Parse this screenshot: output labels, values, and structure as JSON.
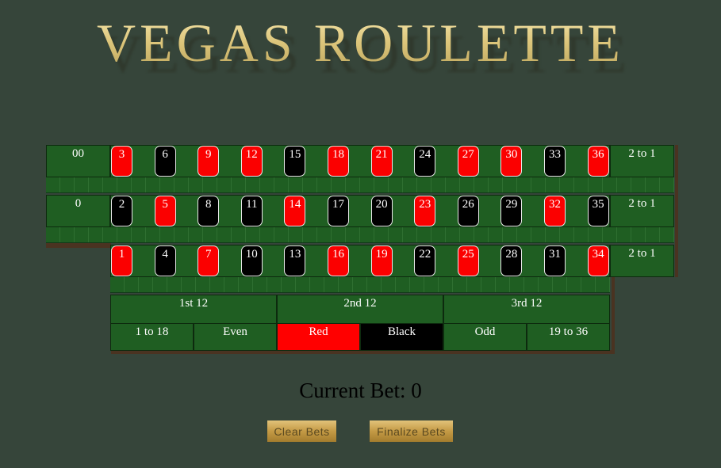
{
  "title": "VEGAS ROULETTE",
  "board": {
    "zeros": [
      "00",
      "0"
    ],
    "rows": [
      [
        {
          "n": "3",
          "c": "red"
        },
        {
          "n": "6",
          "c": "black"
        },
        {
          "n": "9",
          "c": "red"
        },
        {
          "n": "12",
          "c": "red"
        },
        {
          "n": "15",
          "c": "black"
        },
        {
          "n": "18",
          "c": "red"
        },
        {
          "n": "21",
          "c": "red"
        },
        {
          "n": "24",
          "c": "black"
        },
        {
          "n": "27",
          "c": "red"
        },
        {
          "n": "30",
          "c": "red"
        },
        {
          "n": "33",
          "c": "black"
        },
        {
          "n": "36",
          "c": "red"
        }
      ],
      [
        {
          "n": "2",
          "c": "black"
        },
        {
          "n": "5",
          "c": "red"
        },
        {
          "n": "8",
          "c": "black"
        },
        {
          "n": "11",
          "c": "black"
        },
        {
          "n": "14",
          "c": "red"
        },
        {
          "n": "17",
          "c": "black"
        },
        {
          "n": "20",
          "c": "black"
        },
        {
          "n": "23",
          "c": "red"
        },
        {
          "n": "26",
          "c": "black"
        },
        {
          "n": "29",
          "c": "black"
        },
        {
          "n": "32",
          "c": "red"
        },
        {
          "n": "35",
          "c": "black"
        }
      ],
      [
        {
          "n": "1",
          "c": "red"
        },
        {
          "n": "4",
          "c": "black"
        },
        {
          "n": "7",
          "c": "red"
        },
        {
          "n": "10",
          "c": "black"
        },
        {
          "n": "13",
          "c": "black"
        },
        {
          "n": "16",
          "c": "red"
        },
        {
          "n": "19",
          "c": "red"
        },
        {
          "n": "22",
          "c": "black"
        },
        {
          "n": "25",
          "c": "red"
        },
        {
          "n": "28",
          "c": "black"
        },
        {
          "n": "31",
          "c": "black"
        },
        {
          "n": "34",
          "c": "red"
        }
      ]
    ],
    "column_bets": [
      "2 to 1",
      "2 to 1",
      "2 to 1"
    ],
    "dozens": [
      "1st 12",
      "2nd 12",
      "3rd 12"
    ],
    "outside": [
      {
        "label": "1 to 18",
        "c": "green"
      },
      {
        "label": "Even",
        "c": "green"
      },
      {
        "label": "Red",
        "c": "red"
      },
      {
        "label": "Black",
        "c": "black"
      },
      {
        "label": "Odd",
        "c": "green"
      },
      {
        "label": "19 to 36",
        "c": "green"
      }
    ]
  },
  "current_bet_label": "Current Bet:",
  "current_bet_value": "0",
  "buttons": {
    "clear": "Clear Bets",
    "finalize": "Finalize Bets"
  },
  "colors": {
    "felt": "#1f5e22",
    "red": "#ff0000",
    "black": "#000000",
    "background": "#36453a",
    "gold": "#dcc57a"
  }
}
